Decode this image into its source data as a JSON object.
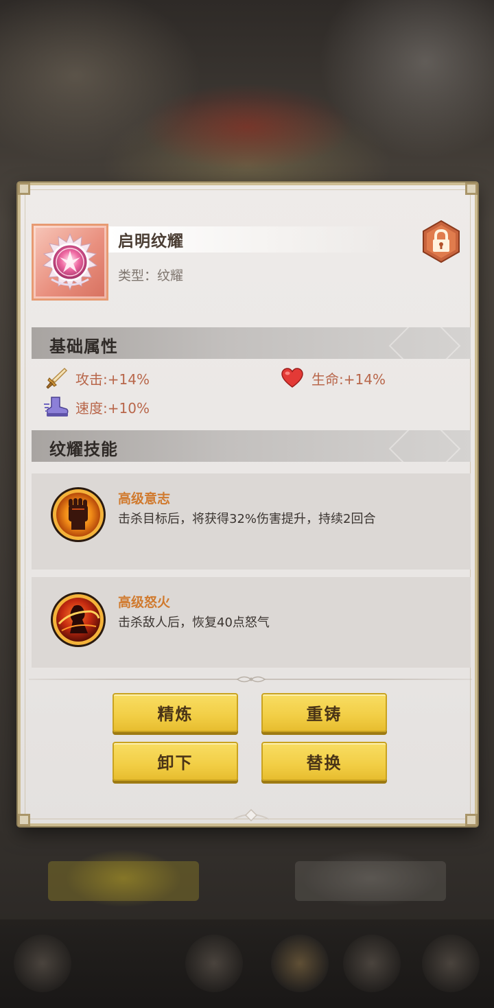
{
  "item": {
    "name": "启明纹耀",
    "type_label": "类型：纹耀",
    "icon": "glyph-emblem-icon",
    "lock_icon": "lock-icon"
  },
  "base_attributes": {
    "title": "基础属性",
    "stats": [
      {
        "icon": "sword-icon",
        "label": "攻击:+14%"
      },
      {
        "icon": "heart-icon",
        "label": "生命:+14%"
      },
      {
        "icon": "boot-icon",
        "label": "速度:+10%"
      }
    ]
  },
  "skills": {
    "title": "纹耀技能",
    "list": [
      {
        "icon": "fist-icon",
        "name": "高级意志",
        "description": "击杀目标后，将获得32%伤害提升，持续2回合"
      },
      {
        "icon": "flame-warrior-icon",
        "name": "高级怒火",
        "description": "击杀敌人后，恢复40点怒气"
      }
    ]
  },
  "actions": {
    "refine": "精炼",
    "reforge": "重铸",
    "unequip": "卸下",
    "replace": "替换"
  },
  "colors": {
    "panel_bg": "#e8e5e3",
    "frame_gold": "#cdbd93",
    "stat_text": "#b8664a",
    "skill_name": "#d07a2e",
    "button_yellow": "#f2ce45"
  }
}
